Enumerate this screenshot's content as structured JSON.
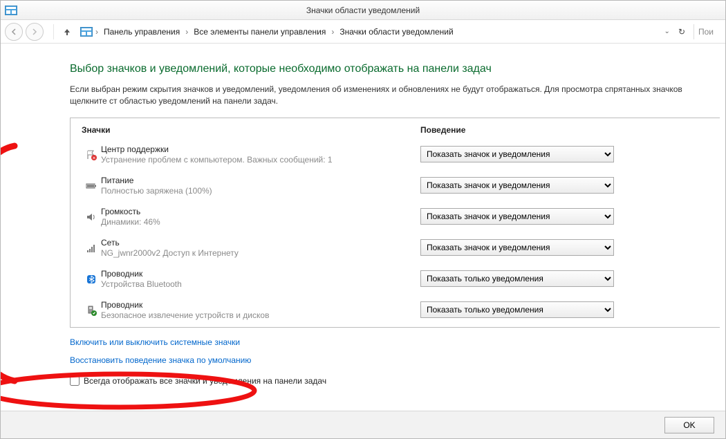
{
  "window": {
    "title": "Значки области уведомлений"
  },
  "nav": {
    "breadcrumbs": [
      "Панель управления",
      "Все элементы панели управления",
      "Значки области уведомлений"
    ],
    "search_placeholder": "Пои"
  },
  "page": {
    "title": "Выбор значков и уведомлений, которые необходимо отображать на панели задач",
    "description": "Если выбран режим скрытия значков и уведомлений, уведомления об изменениях и обновлениях не будут отображаться. Для просмотра спрятанных значков щелкните ст областью уведомлений на панели задач."
  },
  "headers": {
    "icons": "Значки",
    "behavior": "Поведение"
  },
  "behavior_options": [
    "Показать значок и уведомления",
    "Показать только уведомления"
  ],
  "items": [
    {
      "icon": "flag-alert",
      "name": "Центр поддержки",
      "sub": "Устранение проблем с компьютером. Важных сообщений: 1",
      "value": "Показать значок и уведомления"
    },
    {
      "icon": "battery",
      "name": "Питание",
      "sub": "Полностью заряжена (100%)",
      "value": "Показать значок и уведомления"
    },
    {
      "icon": "speaker",
      "name": "Громкость",
      "sub": "Динамики: 46%",
      "value": "Показать значок и уведомления"
    },
    {
      "icon": "network-bars",
      "name": "Сеть",
      "sub": "NG_jwnr2000v2 Доступ к Интернету",
      "value": "Показать значок и уведомления"
    },
    {
      "icon": "bluetooth",
      "name": "Проводник",
      "sub": "Устройства Bluetooth",
      "value": "Показать только уведомления"
    },
    {
      "icon": "usb-eject",
      "name": "Проводник",
      "sub": "Безопасное извлечение устройств и дисков",
      "value": "Показать только уведомления"
    }
  ],
  "links": {
    "system_icons": "Включить или выключить системные значки",
    "restore_defaults": "Восстановить поведение значка по умолчанию"
  },
  "checkbox": {
    "label": "Всегда отображать все значки и уведомления на панели задач",
    "checked": false
  },
  "buttons": {
    "ok": "OK"
  }
}
